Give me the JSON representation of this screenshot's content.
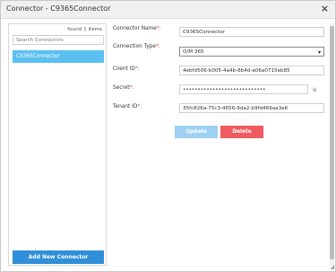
{
  "window": {
    "title": "Connector - C9365Connector",
    "close_glyph": "×"
  },
  "sidebar": {
    "found_text": "found 1 items",
    "search_placeholder": "Search Connectors",
    "items": [
      {
        "label": "C9365Connector",
        "selected": true
      }
    ],
    "add_button_label": "Add New Connector"
  },
  "form": {
    "connector_name": {
      "label": "Connector Name",
      "required": "*:",
      "value": "C9365Connector"
    },
    "connection_type": {
      "label": "Connection Type",
      "required": "*:",
      "value": "O/M 365"
    },
    "client_id": {
      "label": "Client ID",
      "required": "*:",
      "value": "4ebfd506-b005-4a4b-8b4d-a06a0715eb85"
    },
    "secret": {
      "label": "Secret",
      "required": "*:",
      "value": "••••••••••••••••••••••••••••"
    },
    "tenant_id": {
      "label": "Tenant ID",
      "required": "*:",
      "value": "35fc826a-75c3-4656-9da2-b9fd469aa3e6"
    },
    "update_label": "Update",
    "delete_label": "Delete"
  },
  "icons": {
    "close": "close-icon",
    "caret": "chevron-down-icon",
    "eye": "eye-icon"
  },
  "colors": {
    "accent": "#2f8fd8",
    "selected_item": "#5bc0f0",
    "delete": "#ef5b60",
    "update_disabled": "#9dd0f2",
    "required": "#d9534f"
  }
}
